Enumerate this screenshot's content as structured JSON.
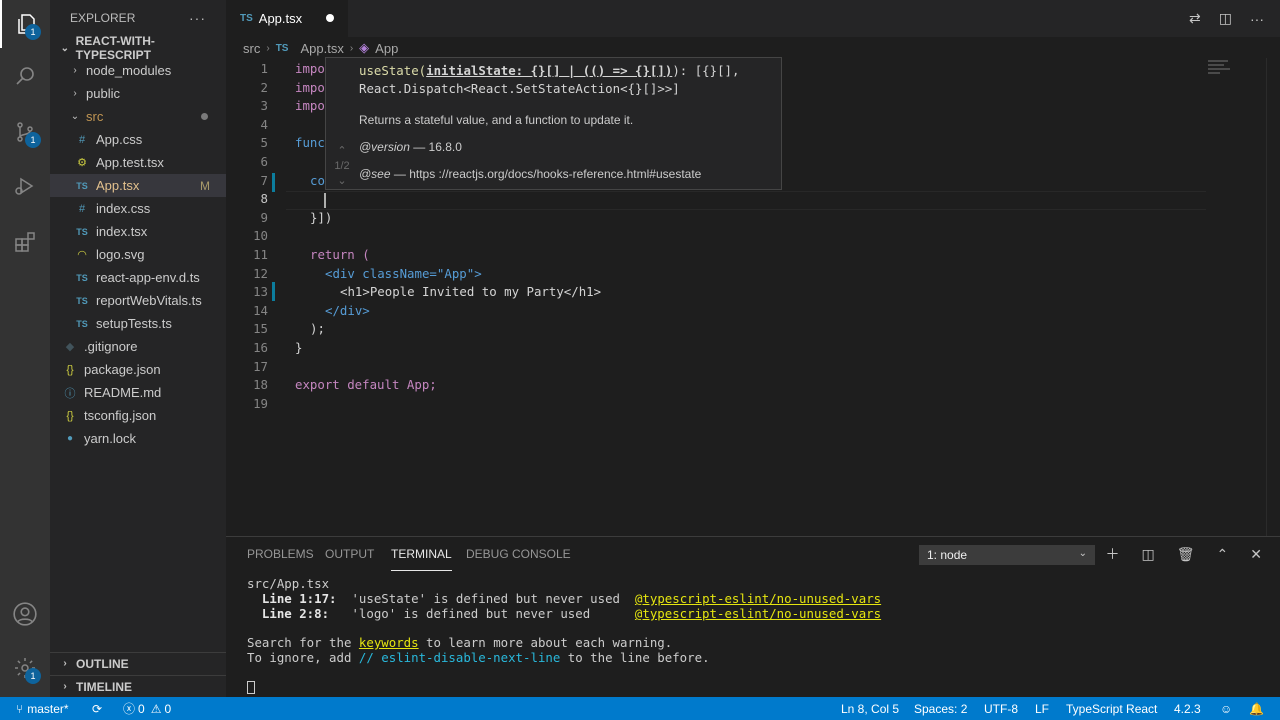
{
  "activity_bar": {
    "explorer_badge": "1",
    "scm_badge": "1",
    "settings_badge": "1"
  },
  "sidebar": {
    "title": "EXPLORER",
    "project": "REACT-WITH-TYPESCRIPT",
    "tree": [
      {
        "label": "node_modules",
        "type": "folder"
      },
      {
        "label": "public",
        "type": "folder"
      },
      {
        "label": "src",
        "type": "folder-open"
      },
      {
        "label": "App.css",
        "icon": "#"
      },
      {
        "label": "App.test.tsx",
        "icon": "⚙"
      },
      {
        "label": "App.tsx",
        "icon": "TS",
        "status": "M"
      },
      {
        "label": "index.css",
        "icon": "#"
      },
      {
        "label": "index.tsx",
        "icon": "TS"
      },
      {
        "label": "logo.svg",
        "icon": "◠"
      },
      {
        "label": "react-app-env.d.ts",
        "icon": "TS"
      },
      {
        "label": "reportWebVitals.ts",
        "icon": "TS"
      },
      {
        "label": "setupTests.ts",
        "icon": "TS"
      },
      {
        "label": ".gitignore",
        "icon": "◆"
      },
      {
        "label": "package.json",
        "icon": "{}"
      },
      {
        "label": "README.md",
        "icon": "ⓘ"
      },
      {
        "label": "tsconfig.json",
        "icon": "{}"
      },
      {
        "label": "yarn.lock",
        "icon": "🧶"
      }
    ],
    "outline": "OUTLINE",
    "timeline": "TIMELINE"
  },
  "editor": {
    "tab_label": "App.tsx",
    "tab_icon": "TS",
    "breadcrumb": [
      "src",
      "App.tsx",
      "App"
    ],
    "lines": [
      {
        "n": "1",
        "t": "impo"
      },
      {
        "n": "2",
        "t": "impo"
      },
      {
        "n": "3",
        "t": "impo"
      },
      {
        "n": "4",
        "t": ""
      },
      {
        "n": "5",
        "t": "func"
      },
      {
        "n": "6",
        "t": ""
      },
      {
        "n": "7",
        "t": "co"
      },
      {
        "n": "8",
        "t": ""
      },
      {
        "n": "9",
        "t": "}])"
      },
      {
        "n": "10",
        "t": ""
      },
      {
        "n": "11",
        "t": "return ("
      },
      {
        "n": "12",
        "t": "<div className=\"App\">"
      },
      {
        "n": "13",
        "t": "<h1>People Invited to my Party</h1>"
      },
      {
        "n": "14",
        "t": "</div>"
      },
      {
        "n": "15",
        "t": ");"
      },
      {
        "n": "16",
        "t": "}"
      },
      {
        "n": "17",
        "t": ""
      },
      {
        "n": "18",
        "t": "export default App;"
      },
      {
        "n": "19",
        "t": ""
      }
    ],
    "hover": {
      "sig_fn": "useState(",
      "sig_param": "initialState: {}[] | (() => {}[])",
      "sig_rest": "): [{}[],",
      "sig_line2": "React.Dispatch<React.SetStateAction<{}[]>>]",
      "description": "Returns a stateful value, and a function to update it.",
      "version_tag": "@version",
      "version_value": " — 16.8.0",
      "see_tag": "@see",
      "see_value": " — https ://reactjs.org/docs/hooks-reference.html#usestate",
      "overload": "1/2"
    }
  },
  "panel": {
    "tabs": [
      "PROBLEMS",
      "OUTPUT",
      "TERMINAL",
      "DEBUG CONSOLE"
    ],
    "terminal_select": "1: node",
    "terminal": {
      "file": "src/App.tsx",
      "w1_loc": "  Line 1:17:",
      "w1_msg": "  'useState' is defined but never used  ",
      "w1_rule": "@typescript-eslint/no-unused-vars",
      "w2_loc": "  Line 2:8:",
      "w2_msg": "   'logo' is defined but never used      ",
      "w2_rule": "@typescript-eslint/no-unused-vars",
      "search_pre": "Search for the ",
      "search_kw": "keywords",
      "search_post": " to learn more about each warning.",
      "ignore_pre": "To ignore, add ",
      "ignore_kw": "// eslint-disable-next-line",
      "ignore_post": " to the line before."
    }
  },
  "status_bar": {
    "branch": "master*",
    "errors": "0",
    "warnings": "0",
    "position": "Ln 8, Col 5",
    "spaces": "Spaces: 2",
    "encoding": "UTF-8",
    "eol": "LF",
    "language": "TypeScript React",
    "version": "4.2.3"
  }
}
